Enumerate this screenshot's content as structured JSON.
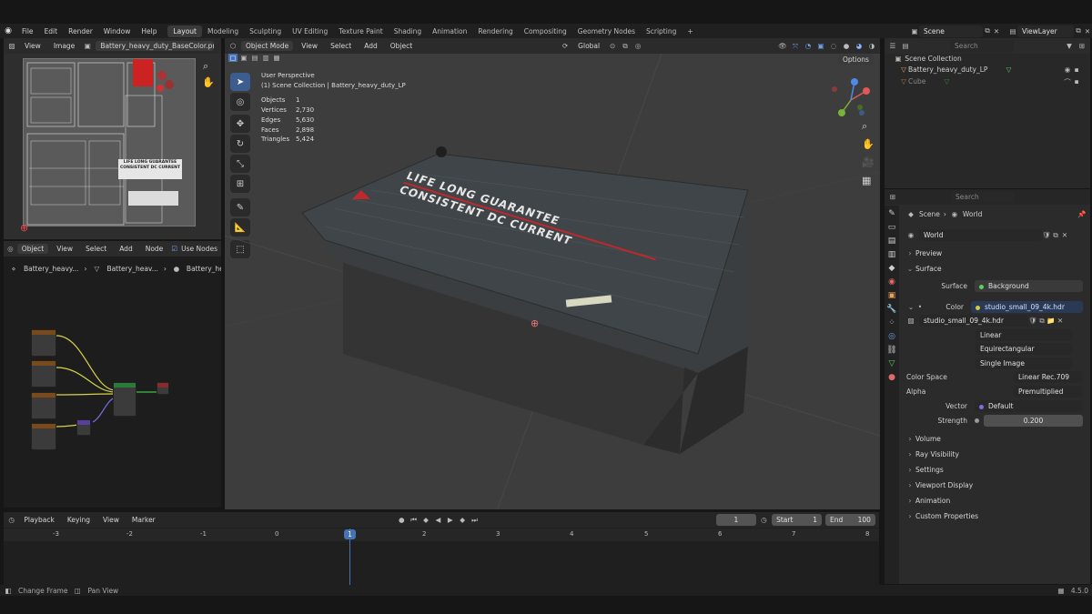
{
  "menus": [
    "File",
    "Edit",
    "Render",
    "Window",
    "Help"
  ],
  "workspaces": [
    "Layout",
    "Modeling",
    "Sculpting",
    "UV Editing",
    "Texture Paint",
    "Shading",
    "Animation",
    "Rendering",
    "Compositing",
    "Geometry Nodes",
    "Scripting",
    "+"
  ],
  "topright": {
    "scene": "Scene",
    "view_layer": "ViewLayer"
  },
  "image_editor": {
    "menu_view": "View",
    "menu_image": "Image",
    "image_name": "Battery_heavy_duty_BaseColor.png",
    "label_line1": "LIFE LONG GUARANTEE",
    "label_line2": "CONSISTENT DC CURRENT"
  },
  "node_editor": {
    "mode": "Object",
    "menu": [
      "View",
      "Select",
      "Add",
      "Node"
    ],
    "use_nodes": "Use Nodes",
    "breadcrumb": [
      "Battery_heavy...",
      "Battery_heav...",
      "Battery_he..."
    ]
  },
  "viewport": {
    "mode": "Object Mode",
    "menu": [
      "View",
      "Select",
      "Add",
      "Object"
    ],
    "orientation": "Global",
    "options": "Options",
    "perspective": "User Perspective",
    "collection": "(1) Scene Collection | Battery_heavy_duty_LP",
    "stats": [
      {
        "k": "Objects",
        "v": "1"
      },
      {
        "k": "Vertices",
        "v": "2,730"
      },
      {
        "k": "Edges",
        "v": "5,630"
      },
      {
        "k": "Faces",
        "v": "2,898"
      },
      {
        "k": "Triangles",
        "v": "5,424"
      }
    ],
    "lid_text1": "LIFE LONG GUARANTEE",
    "lid_text2": "CONSISTENT DC CURRENT"
  },
  "outliner": {
    "search_placeholder": "Search",
    "root": "Scene Collection",
    "items": [
      "Battery_heavy_duty_LP",
      "Cube"
    ]
  },
  "properties": {
    "search_placeholder": "Search",
    "breadcrumb_scene": "Scene",
    "breadcrumb_world": "World",
    "world_name": "World",
    "preview": "Preview",
    "surface_section": "Surface",
    "surface_label": "Surface",
    "surface_value": "Background",
    "color_label": "Color",
    "color_value": "studio_small_09_4k.hdr",
    "image_name": "studio_small_09_4k.hdr",
    "interp": "Linear",
    "projection": "Equirectangular",
    "source": "Single Image",
    "color_space_label": "Color Space",
    "color_space": "Linear Rec.709",
    "alpha_label": "Alpha",
    "alpha": "Premultiplied",
    "vector_label": "Vector",
    "vector": "Default",
    "strength_label": "Strength",
    "strength": "0.200",
    "sections": [
      "Volume",
      "Ray Visibility",
      "Settings",
      "Viewport Display",
      "Animation",
      "Custom Properties"
    ]
  },
  "timeline": {
    "menu": [
      "Playback",
      "Keying",
      "View",
      "Marker"
    ],
    "current_frame": "1",
    "start_label": "Start",
    "start": "1",
    "end_label": "End",
    "end": "100",
    "ticks": [
      "-3",
      "-2",
      "-1",
      "0",
      "1",
      "2",
      "3",
      "4",
      "5",
      "6",
      "7",
      "8"
    ]
  },
  "status": {
    "left1": "Change Frame",
    "left2": "Pan View",
    "version": "4.5.0"
  },
  "colors": {
    "accent": "#4772b3",
    "header": "#2b2b2b",
    "panel": "#1e1e1e",
    "viewport_bg": "#3d3d3d"
  }
}
